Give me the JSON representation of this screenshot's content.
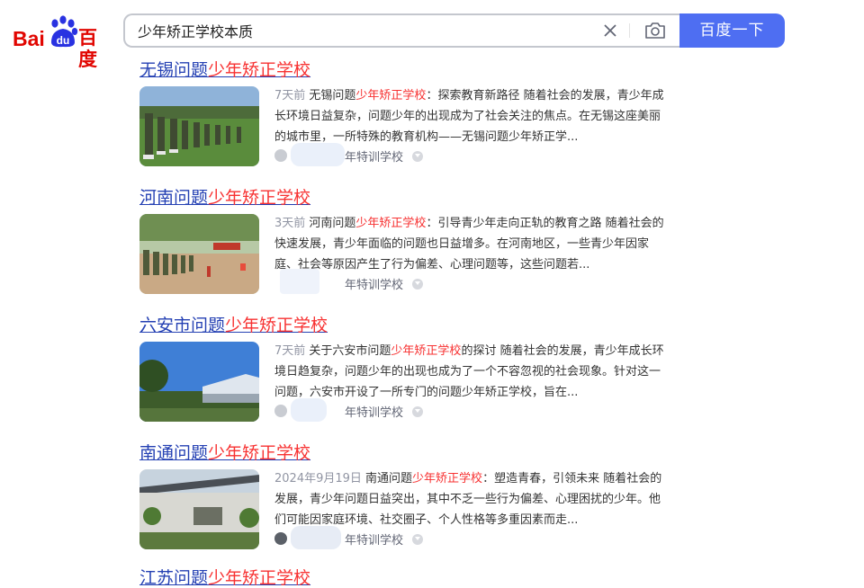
{
  "logo": {
    "bai": "Bai",
    "cn": "百度"
  },
  "search": {
    "query": "少年矫正学校本质",
    "button_label": "百度一下"
  },
  "results": [
    {
      "title_pre": "无锡问题",
      "title_hl": "少年矫正学校",
      "date": "7天前",
      "abs_pre": " 无锡问题",
      "abs_hl": "少年矫正学校",
      "abs_post": "：探索教育新路径 随着社会的发展，青少年成长环境日益复杂，问题少年的出现成为了社会关注的焦点。在无锡这座美丽的城市里，一所特殊的教育机构——无锡问题少年矫正学...",
      "source": "年特训学校"
    },
    {
      "title_pre": "河南问题",
      "title_hl": "少年矫正学校",
      "date": "3天前",
      "abs_pre": " 河南问题",
      "abs_hl": "少年矫正学校",
      "abs_post": "：引导青少年走向正轨的教育之路 随着社会的快速发展，青少年面临的问题也日益增多。在河南地区，一些青少年因家庭、社会等原因产生了行为偏差、心理问题等，这些问题若...",
      "source": "年特训学校"
    },
    {
      "title_pre": "六安市问题",
      "title_hl": "少年矫正学校",
      "date": "7天前",
      "abs_pre": " 关于六安市问题",
      "abs_hl": "少年矫正学校",
      "abs_post": "的探讨 随着社会的发展，青少年成长环境日趋复杂，问题少年的出现也成为了一个不容忽视的社会现象。针对这一问题，六安市开设了一所专门的问题少年矫正学校，旨在...",
      "source": "年特训学校"
    },
    {
      "title_pre": "南通问题",
      "title_hl": "少年矫正学校",
      "date": "2024年9月19日",
      "abs_pre": " 南通问题",
      "abs_hl": "少年矫正学校",
      "abs_post": "：塑造青春，引领未来 随着社会的发展，青少年问题日益突出，其中不乏一些行为偏差、心理困扰的少年。他们可能因家庭环境、社交圈子、个人性格等多重因素而走...",
      "source": "年特训学校"
    }
  ],
  "last_title": {
    "pre": "江苏问题",
    "hl": "少年矫正学校"
  }
}
